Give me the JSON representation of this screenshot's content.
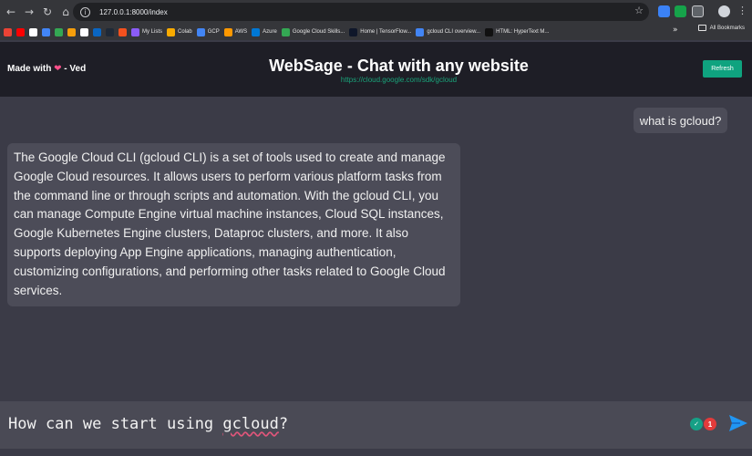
{
  "browser": {
    "url": "127.0.0.1:8000/index",
    "bookmarks": [
      {
        "label": "",
        "color": "#ea4335"
      },
      {
        "label": "",
        "color": "#ff0000"
      },
      {
        "label": "",
        "color": "#ffffff"
      },
      {
        "label": "",
        "color": "#4285f4"
      },
      {
        "label": "",
        "color": "#34a853"
      },
      {
        "label": "",
        "color": "#f59e0b"
      },
      {
        "label": "",
        "color": "#ffffff"
      },
      {
        "label": "",
        "color": "#0a66c2"
      },
      {
        "label": "",
        "color": "#1f2937"
      },
      {
        "label": "",
        "color": "#f4511e"
      },
      {
        "label": "My Lists",
        "color": "#8b5cf6"
      },
      {
        "label": "Colab",
        "color": "#f9ab00"
      },
      {
        "label": "GCP",
        "color": "#4285f4"
      },
      {
        "label": "AWS",
        "color": "#ff9900"
      },
      {
        "label": "Azure",
        "color": "#0078d4"
      },
      {
        "label": "Google Cloud Skills...",
        "color": "#34a853"
      },
      {
        "label": "Home | TensorFlow...",
        "color": "#0f172a"
      },
      {
        "label": "gcloud CLI overview...",
        "color": "#4285f4"
      },
      {
        "label": "HTML: HyperText M...",
        "color": "#111111"
      }
    ],
    "all_bookmarks": "All Bookmarks"
  },
  "header": {
    "made_with": "Made with",
    "author": "- Ved",
    "title": "WebSage - Chat with any website",
    "site_url": "https://cloud.google.com/sdk/gcloud",
    "refresh_label": "Refresh"
  },
  "chat": {
    "user_message": "what is gcloud?",
    "bot_message": "The Google Cloud CLI (gcloud CLI) is a set of tools used to create and manage Google Cloud resources. It allows users to perform various platform tasks from the command line or through scripts and automation. With the gcloud CLI, you can manage Compute Engine virtual machine instances, Cloud SQL instances, Google Kubernetes Engine clusters, Dataproc clusters, and more. It also supports deploying App Engine applications, managing authentication, customizing configurations, and performing other tasks related to Google Cloud services."
  },
  "input": {
    "text_before": "How can we start using ",
    "text_flagged": "gcloud",
    "text_after": "?",
    "grammar_count": "1"
  },
  "colors": {
    "accent": "#0fa37f",
    "send": "#2196f3"
  }
}
